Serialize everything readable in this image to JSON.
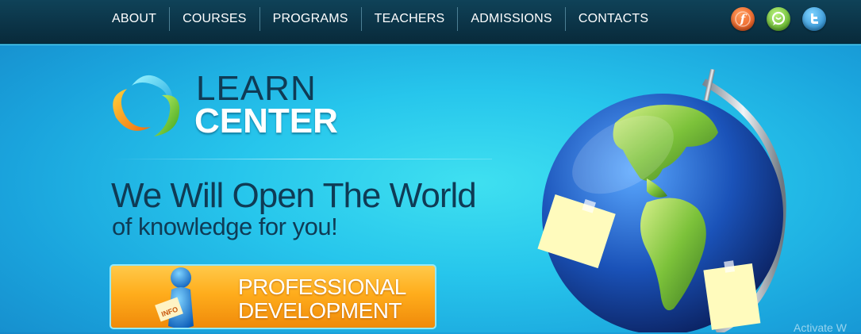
{
  "nav": {
    "items": [
      {
        "label": "ABOUT"
      },
      {
        "label": "COURSES"
      },
      {
        "label": "PROGRAMS"
      },
      {
        "label": "TEACHERS"
      },
      {
        "label": "ADMISSIONS"
      },
      {
        "label": "CONTACTS"
      }
    ]
  },
  "social": [
    {
      "icon": "flickr-like-icon",
      "color": "#e24b12",
      "glyph": "ƒ"
    },
    {
      "icon": "chat-icon",
      "color": "#4ea81a",
      "glyph": "☻"
    },
    {
      "icon": "twitter-bird-icon",
      "color": "#1a7fc6",
      "glyph": "t"
    }
  ],
  "logo": {
    "line1": "LEARN",
    "line2": "CENTER"
  },
  "hero": {
    "headline": "We Will Open The World",
    "subline": "of knowledge for you!"
  },
  "cta": {
    "line1": "PROFESSIONAL",
    "line2": "DEVELOPMENT",
    "badge": "INFO"
  },
  "watermark": "Activate W",
  "colors": {
    "nav_bg": "#0b3346",
    "background": "#27c6ec",
    "headline": "#0f3b55",
    "cta": "#ffad1c"
  }
}
